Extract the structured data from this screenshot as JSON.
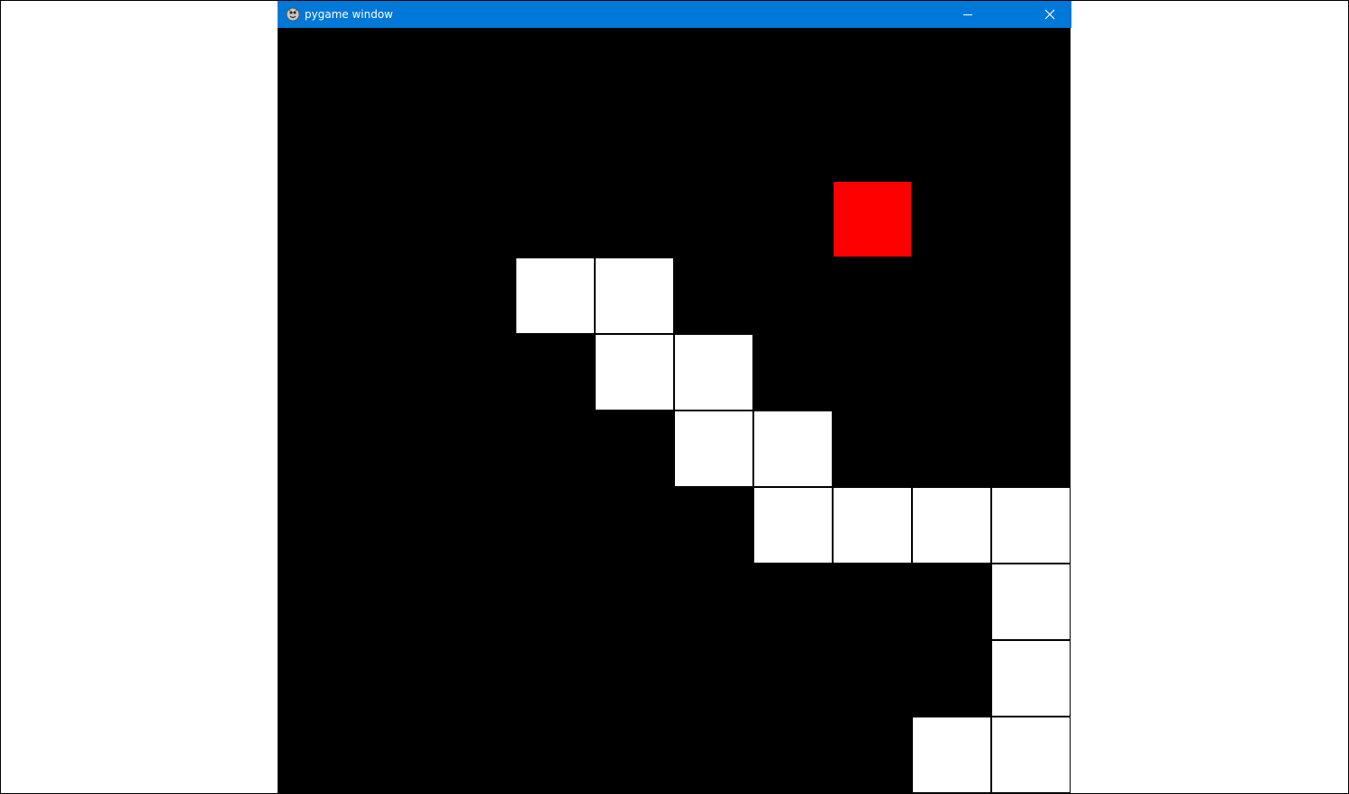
{
  "window": {
    "title": "pygame window"
  },
  "colors": {
    "titlebar": "#0078d7",
    "background": "#000000",
    "snake": "#ffffff",
    "food": "#ff0000"
  },
  "icons": {
    "app": "pygame-snake-icon",
    "minimize": "minimize-icon",
    "close": "close-icon"
  },
  "game": {
    "grid_columns": 10,
    "food": {
      "col": 7,
      "row": 2
    },
    "snake": [
      {
        "col": 3,
        "row": 3
      },
      {
        "col": 4,
        "row": 3
      },
      {
        "col": 4,
        "row": 4
      },
      {
        "col": 5,
        "row": 4
      },
      {
        "col": 5,
        "row": 5
      },
      {
        "col": 6,
        "row": 5
      },
      {
        "col": 6,
        "row": 6
      },
      {
        "col": 7,
        "row": 6
      },
      {
        "col": 8,
        "row": 6
      },
      {
        "col": 9,
        "row": 6
      },
      {
        "col": 9,
        "row": 7
      },
      {
        "col": 9,
        "row": 8
      },
      {
        "col": 9,
        "row": 9
      },
      {
        "col": 8,
        "row": 9
      }
    ]
  }
}
